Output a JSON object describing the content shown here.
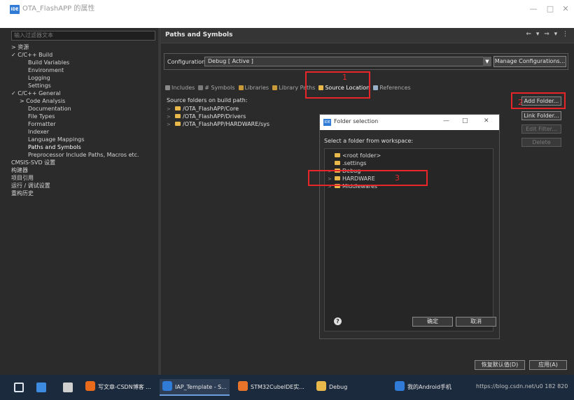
{
  "window": {
    "title": "OTA_FlashAPP 的属性",
    "app_icon": "IDE",
    "controls": [
      "—",
      "□",
      "✕"
    ]
  },
  "sidebar": {
    "filter_placeholder": "输入过滤器文本",
    "items": [
      {
        "label": "> 资源",
        "indent": 0
      },
      {
        "label": "✓ C/C++ Build",
        "indent": 0
      },
      {
        "label": "Build Variables",
        "indent": 2
      },
      {
        "label": "Environment",
        "indent": 2
      },
      {
        "label": "Logging",
        "indent": 2
      },
      {
        "label": "Settings",
        "indent": 2
      },
      {
        "label": "✓ C/C++ General",
        "indent": 0
      },
      {
        "label": "> Code Analysis",
        "indent": 1
      },
      {
        "label": "Documentation",
        "indent": 2
      },
      {
        "label": "File Types",
        "indent": 2
      },
      {
        "label": "Formatter",
        "indent": 2
      },
      {
        "label": "Indexer",
        "indent": 2
      },
      {
        "label": "Language Mappings",
        "indent": 2
      },
      {
        "label": "Paths and Symbols",
        "indent": 2,
        "selected": true
      },
      {
        "label": "Preprocessor Include Paths, Macros etc.",
        "indent": 2
      },
      {
        "label": "CMSIS-SVD 设置",
        "indent": 0
      },
      {
        "label": "构建器",
        "indent": 0
      },
      {
        "label": "项目引用",
        "indent": 0
      },
      {
        "label": "运行 / 调试设置",
        "indent": 0
      },
      {
        "label": "重构历史",
        "indent": 0
      }
    ]
  },
  "main": {
    "page_title": "Paths and Symbols",
    "nav_arrows": "⇐ ▾ ⇒ ▾ ⋮",
    "configuration_label": "Configuration:",
    "configuration_value": "Debug  [ Active ]",
    "manage_configurations": "Manage Configurations...",
    "tabs": [
      {
        "label": "Includes",
        "color": "#8a8a8a"
      },
      {
        "label": "# Symbols",
        "color": "#7a7a7a"
      },
      {
        "label": "Libraries",
        "color": "#c89a3a"
      },
      {
        "label": "Library Paths",
        "color": "#c89a3a"
      },
      {
        "label": "Source Location",
        "color": "#e8b84a",
        "active": true
      },
      {
        "label": "References",
        "color": "#9ab0c8"
      }
    ],
    "source_folders_label": "Source folders on build path:",
    "source_folders": [
      "/OTA_FlashAPP/Core",
      "/OTA_FlashAPP/Drivers",
      "/OTA_FlashAPP/HARDWARE/sys"
    ],
    "buttons": {
      "add_folder": "Add Folder...",
      "link_folder": "Link Folder...",
      "edit_filter": "Edit Filter...",
      "delete": "Delete"
    },
    "restore_defaults": "恢复默认值(D)",
    "apply": "应用(A)"
  },
  "dialog": {
    "title": "Folder selection",
    "icon": "IDE",
    "controls": [
      "—",
      "□",
      "✕"
    ],
    "prompt": "Select a folder from workspace:",
    "items": [
      {
        "label": "<root folder>",
        "indent": 1,
        "expandable": false
      },
      {
        "label": ".settings",
        "indent": 1,
        "expandable": false
      },
      {
        "label": "Debug",
        "indent": 0,
        "expandable": true
      },
      {
        "label": "HARDWARE",
        "indent": 0,
        "expandable": true
      },
      {
        "label": "Middlewares",
        "indent": 0,
        "expandable": true
      }
    ],
    "ok": "确定",
    "cancel": "取消",
    "help": "?"
  },
  "annotations": [
    "1",
    "2",
    "3"
  ],
  "taskbar": {
    "apps": [
      {
        "label": "写文章-CSDN博客 ...",
        "color": "#e86a1a"
      },
      {
        "label": "IAP_Template - S...",
        "color": "#2f7bd6",
        "active": true
      },
      {
        "label": "STM32CubeIDE实...",
        "color": "#e8742a"
      },
      {
        "label": "Debug",
        "color": "#e8b84a"
      },
      {
        "label": "我的Android手机",
        "color": "#2f7bd6"
      }
    ],
    "url": "https://blog.csdn.net/u0 182 820"
  }
}
